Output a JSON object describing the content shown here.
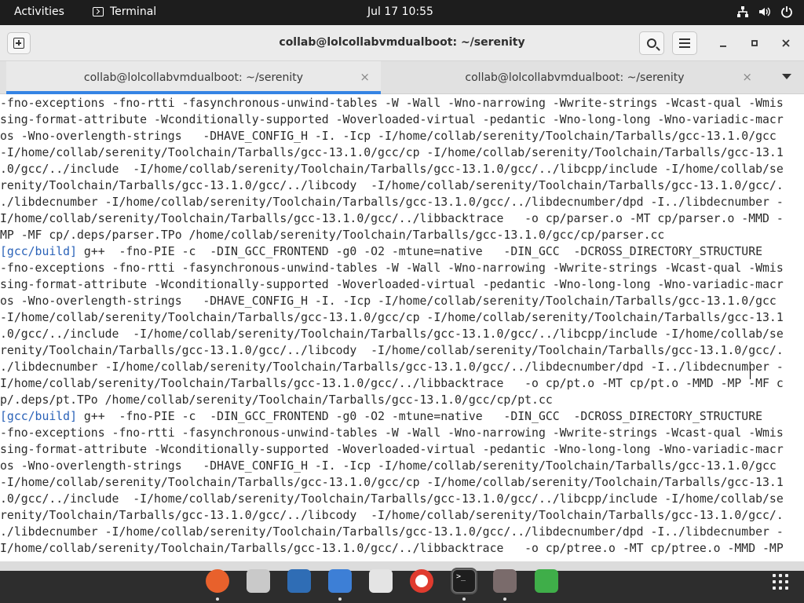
{
  "topbar": {
    "activities": "Activities",
    "app_name": "Terminal",
    "clock": "Jul 17  10:55",
    "tray_icons": [
      "network-icon",
      "volume-icon",
      "power-icon"
    ]
  },
  "window": {
    "title": "collab@lolcollabvmdualboot: ~/serenity",
    "new_tab_icon": "new-tab-icon",
    "search_icon": "search-icon",
    "menu_icon": "hamburger-menu-icon",
    "minimize": "–",
    "maximize": "▫",
    "close": "✕"
  },
  "tabs": [
    {
      "label": "collab@lolcollabvmdualboot: ~/serenity",
      "active": true,
      "close": "×"
    },
    {
      "label": "collab@lolcollabvmdualboot: ~/serenity",
      "active": false,
      "close": "×"
    }
  ],
  "terminal": {
    "accent": "#2a62b8",
    "lines": [
      {
        "p": "",
        "t": "-fno-exceptions -fno-rtti -fasynchronous-unwind-tables -W -Wall -Wno-narrowing -Wwrite-strings -Wcast-qual -Wmis"
      },
      {
        "p": "",
        "t": "sing-format-attribute -Wconditionally-supported -Woverloaded-virtual -pedantic -Wno-long-long -Wno-variadic-macr"
      },
      {
        "p": "",
        "t": "os -Wno-overlength-strings   -DHAVE_CONFIG_H -I. -Icp -I/home/collab/serenity/Toolchain/Tarballs/gcc-13.1.0/gcc"
      },
      {
        "p": "",
        "t": "-I/home/collab/serenity/Toolchain/Tarballs/gcc-13.1.0/gcc/cp -I/home/collab/serenity/Toolchain/Tarballs/gcc-13.1"
      },
      {
        "p": "",
        "t": ".0/gcc/../include  -I/home/collab/serenity/Toolchain/Tarballs/gcc-13.1.0/gcc/../libcpp/include -I/home/collab/se"
      },
      {
        "p": "",
        "t": "renity/Toolchain/Tarballs/gcc-13.1.0/gcc/../libcody  -I/home/collab/serenity/Toolchain/Tarballs/gcc-13.1.0/gcc/."
      },
      {
        "p": "",
        "t": "./libdecnumber -I/home/collab/serenity/Toolchain/Tarballs/gcc-13.1.0/gcc/../libdecnumber/dpd -I../libdecnumber -"
      },
      {
        "p": "",
        "t": "I/home/collab/serenity/Toolchain/Tarballs/gcc-13.1.0/gcc/../libbacktrace   -o cp/parser.o -MT cp/parser.o -MMD -"
      },
      {
        "p": "",
        "t": "MP -MF cp/.deps/parser.TPo /home/collab/serenity/Toolchain/Tarballs/gcc-13.1.0/gcc/cp/parser.cc"
      },
      {
        "p": "[gcc/build]",
        "t": " g++  -fno-PIE -c  -DIN_GCC_FRONTEND -g0 -O2 -mtune=native   -DIN_GCC  -DCROSS_DIRECTORY_STRUCTURE"
      },
      {
        "p": "",
        "t": "-fno-exceptions -fno-rtti -fasynchronous-unwind-tables -W -Wall -Wno-narrowing -Wwrite-strings -Wcast-qual -Wmis"
      },
      {
        "p": "",
        "t": "sing-format-attribute -Wconditionally-supported -Woverloaded-virtual -pedantic -Wno-long-long -Wno-variadic-macr"
      },
      {
        "p": "",
        "t": "os -Wno-overlength-strings   -DHAVE_CONFIG_H -I. -Icp -I/home/collab/serenity/Toolchain/Tarballs/gcc-13.1.0/gcc"
      },
      {
        "p": "",
        "t": "-I/home/collab/serenity/Toolchain/Tarballs/gcc-13.1.0/gcc/cp -I/home/collab/serenity/Toolchain/Tarballs/gcc-13.1"
      },
      {
        "p": "",
        "t": ".0/gcc/../include  -I/home/collab/serenity/Toolchain/Tarballs/gcc-13.1.0/gcc/../libcpp/include -I/home/collab/se"
      },
      {
        "p": "",
        "t": "renity/Toolchain/Tarballs/gcc-13.1.0/gcc/../libcody  -I/home/collab/serenity/Toolchain/Tarballs/gcc-13.1.0/gcc/."
      },
      {
        "p": "",
        "t": "./libdecnumber -I/home/collab/serenity/Toolchain/Tarballs/gcc-13.1.0/gcc/../libdecnumber/dpd -I../libdecnumber -"
      },
      {
        "p": "",
        "t": "I/home/collab/serenity/Toolchain/Tarballs/gcc-13.1.0/gcc/../libbacktrace   -o cp/pt.o -MT cp/pt.o -MMD -MP -MF c"
      },
      {
        "p": "",
        "t": "p/.deps/pt.TPo /home/collab/serenity/Toolchain/Tarballs/gcc-13.1.0/gcc/cp/pt.cc"
      },
      {
        "p": "[gcc/build]",
        "t": " g++  -fno-PIE -c  -DIN_GCC_FRONTEND -g0 -O2 -mtune=native   -DIN_GCC  -DCROSS_DIRECTORY_STRUCTURE"
      },
      {
        "p": "",
        "t": "-fno-exceptions -fno-rtti -fasynchronous-unwind-tables -W -Wall -Wno-narrowing -Wwrite-strings -Wcast-qual -Wmis"
      },
      {
        "p": "",
        "t": "sing-format-attribute -Wconditionally-supported -Woverloaded-virtual -pedantic -Wno-long-long -Wno-variadic-macr"
      },
      {
        "p": "",
        "t": "os -Wno-overlength-strings   -DHAVE_CONFIG_H -I. -Icp -I/home/collab/serenity/Toolchain/Tarballs/gcc-13.1.0/gcc"
      },
      {
        "p": "",
        "t": "-I/home/collab/serenity/Toolchain/Tarballs/gcc-13.1.0/gcc/cp -I/home/collab/serenity/Toolchain/Tarballs/gcc-13.1"
      },
      {
        "p": "",
        "t": ".0/gcc/../include  -I/home/collab/serenity/Toolchain/Tarballs/gcc-13.1.0/gcc/../libcpp/include -I/home/collab/se"
      },
      {
        "p": "",
        "t": "renity/Toolchain/Tarballs/gcc-13.1.0/gcc/../libcody  -I/home/collab/serenity/Toolchain/Tarballs/gcc-13.1.0/gcc/."
      },
      {
        "p": "",
        "t": "./libdecnumber -I/home/collab/serenity/Toolchain/Tarballs/gcc-13.1.0/gcc/../libdecnumber/dpd -I../libdecnumber -"
      },
      {
        "p": "",
        "t": "I/home/collab/serenity/Toolchain/Tarballs/gcc-13.1.0/gcc/../libbacktrace   -o cp/ptree.o -MT cp/ptree.o -MMD -MP"
      }
    ]
  },
  "dock": {
    "items": [
      {
        "name": "firefox-icon",
        "color": "#e8612c",
        "running": true
      },
      {
        "name": "deja-dup-backup-icon",
        "color": "#c9c9c9",
        "running": false
      },
      {
        "name": "libreoffice-writer-icon",
        "color": "#2f6db5",
        "running": false
      },
      {
        "name": "text-editor-icon",
        "color": "#3d7fd6",
        "running": true
      },
      {
        "name": "software-center-icon",
        "color": "#e4e4e4",
        "running": false
      },
      {
        "name": "help-lifebuoy-icon",
        "color": "#e03b2e",
        "running": false
      },
      {
        "name": "terminal-icon",
        "color": "#1e1e1e",
        "running": true
      },
      {
        "name": "virtual-machine-manager-icon",
        "color": "#7a6b6b",
        "running": true
      },
      {
        "name": "trash-icon",
        "color": "#3fae49",
        "running": false
      }
    ],
    "apps_grid_icon": "show-applications-icon"
  }
}
